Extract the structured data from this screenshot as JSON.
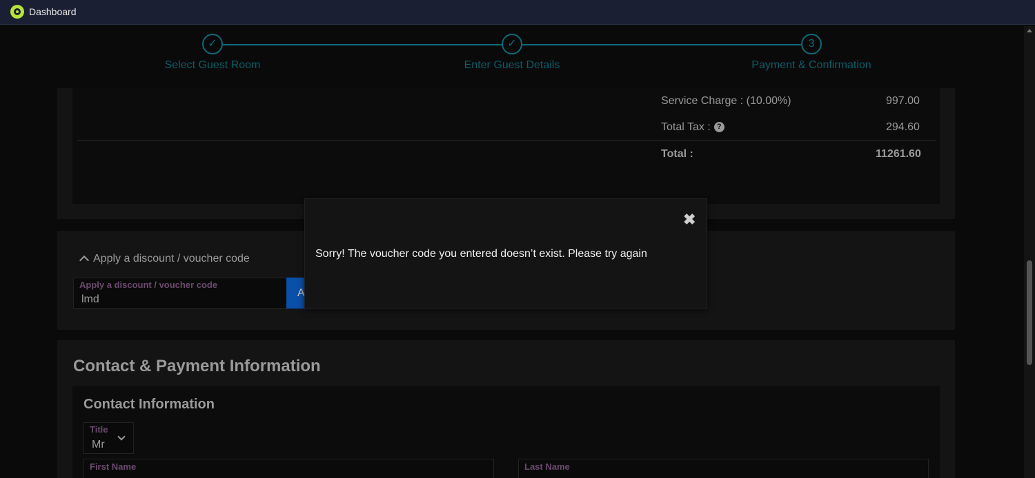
{
  "window": {
    "title": "Dashboard"
  },
  "stepper": {
    "steps": [
      {
        "label": "Select Guest Room",
        "marker": "✓"
      },
      {
        "label": "Enter Guest Details",
        "marker": "✓"
      },
      {
        "label": "Payment & Confirmation",
        "marker": "3"
      }
    ]
  },
  "summary": {
    "service_charge_label": "Service Charge : (10.00%)",
    "service_charge_value": "997.00",
    "total_tax_label": "Total Tax :",
    "total_tax_help": "?",
    "total_tax_value": "294.60",
    "total_label": "Total :",
    "total_value": "11261.60"
  },
  "discount": {
    "toggle_label": "Apply a discount / voucher code",
    "field_label": "Apply a discount / voucher code",
    "field_value": "lmd",
    "apply_button_label": "A"
  },
  "contact": {
    "heading": "Contact & Payment Information",
    "subheading": "Contact Information",
    "title_label": "Title",
    "title_value": "Mr",
    "first_name_label": "First Name",
    "last_name_label": "Last Name"
  },
  "modal": {
    "close_label": "✖",
    "message": "Sorry! The voucher code you entered doesn’t exist. Please try again"
  },
  "colors": {
    "accent": "#0e6a78",
    "apply_button": "#0a4fa8",
    "field_label": "#6b4a6e",
    "app_icon": "#b7e33a"
  }
}
